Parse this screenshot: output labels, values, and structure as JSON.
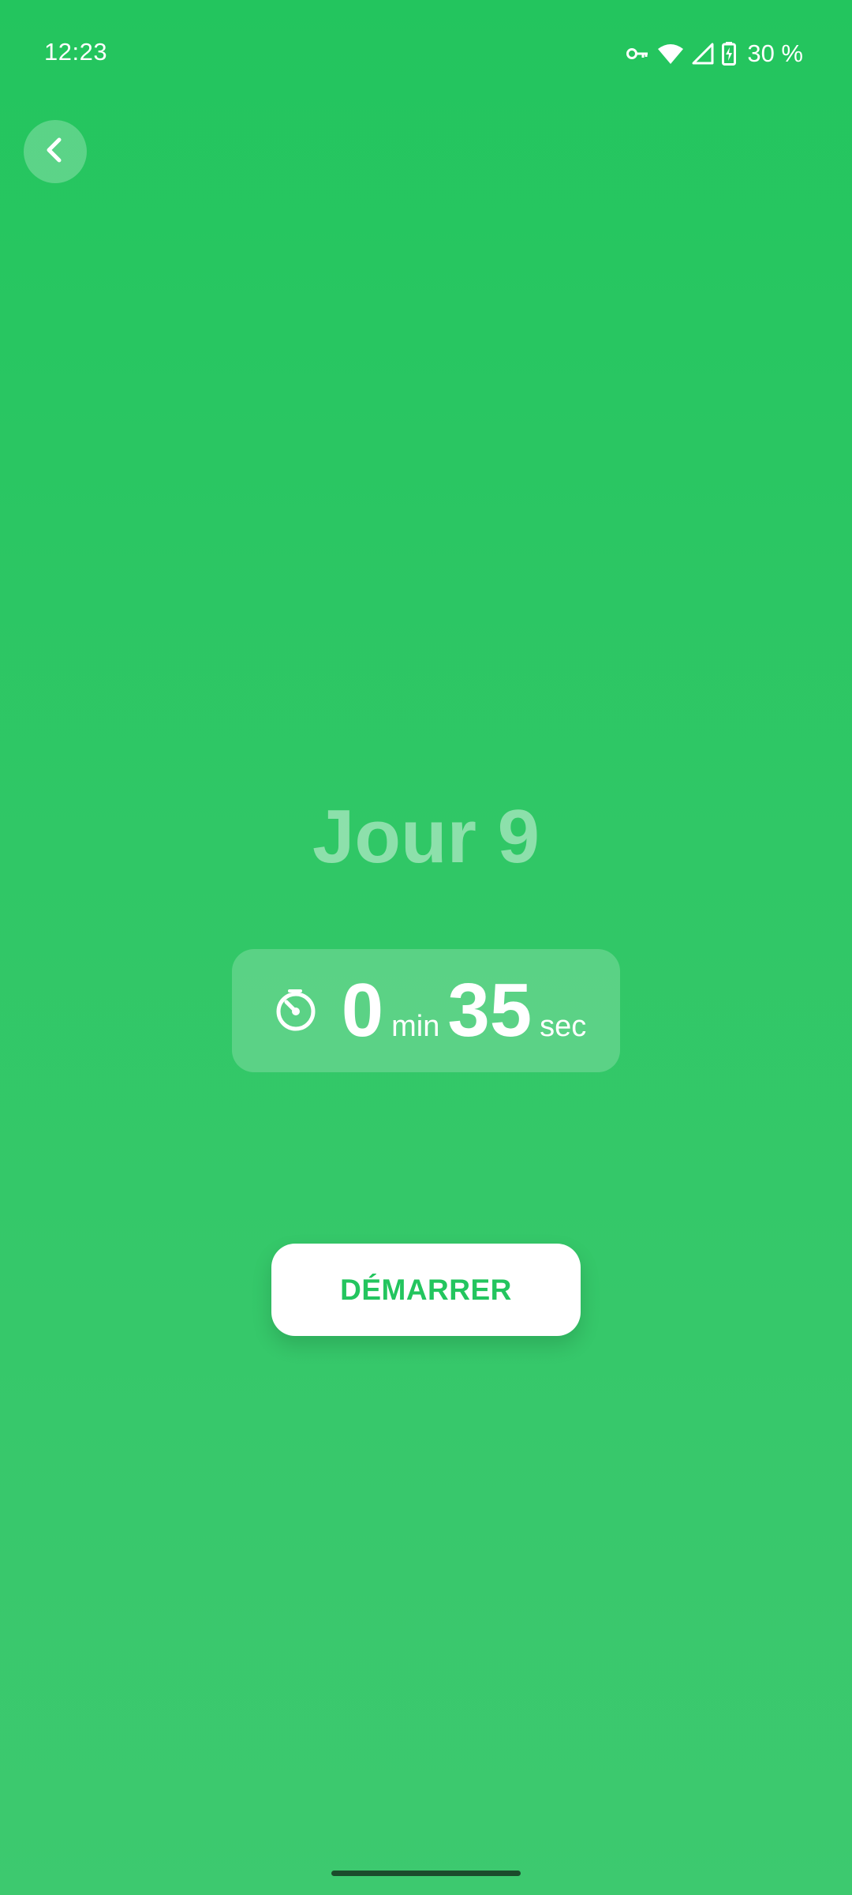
{
  "status_bar": {
    "time": "12:23",
    "battery": "30 %",
    "icons": [
      "vpn-key-icon",
      "wifi-icon",
      "signal-icon",
      "battery-charging-icon"
    ]
  },
  "back_icon": "chevron-left-icon",
  "day_title": "Jour 9",
  "timer": {
    "icon": "stopwatch-icon",
    "minutes": "0",
    "minutes_unit": "min",
    "seconds": "35",
    "seconds_unit": "sec"
  },
  "start_button_label": "DÉMARRER",
  "colors": {
    "background_top": "#23C55E",
    "background_bottom": "#3DC96F",
    "accent": "#23C55E",
    "button_bg": "#FFFFFF"
  }
}
